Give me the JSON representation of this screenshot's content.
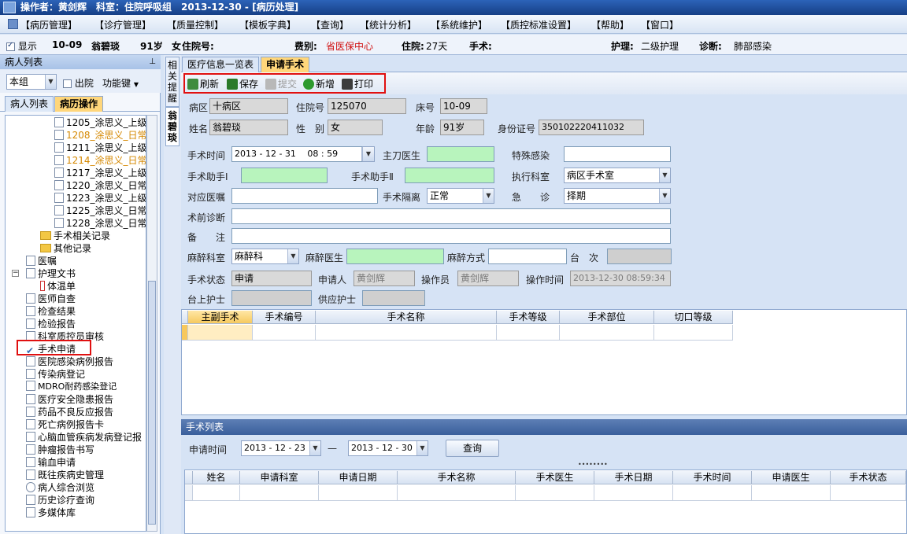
{
  "titlebar": {
    "text": "操作者：黄剑辉　科室：住院呼吸组　2013-12-30 - [病历处理]"
  },
  "menu": [
    "【病历管理】",
    "【诊疗管理】",
    "【质量控制】",
    "【模板字典】",
    "【查询】",
    "【统计分析】",
    "【系统维护】",
    "【质控标准设置】",
    "【帮助】",
    "【窗口】"
  ],
  "patient": {
    "show_label": "显示",
    "bed": "10-09",
    "name": "翁碧琰",
    "age": "91岁",
    "sex": "女",
    "inpatient_label": "住院号:",
    "inpatient_no": "125070",
    "fee_label": "费别:",
    "fee": "省医保中心",
    "stay_label": "住院:",
    "stay": "27天",
    "surgery_label": "手术:",
    "nursing_label": "护理:",
    "nursing": "二级护理",
    "diagnosis_label": "诊断:",
    "diagnosis": "肺部感染"
  },
  "left": {
    "header": "病人列表",
    "group_combo": "本组",
    "discharge_label": "出院",
    "func_label": "功能键",
    "tab_patients": "病人列表",
    "tab_records": "病历操作",
    "tree_top": [
      "1205_涂思义_上级",
      "1208_涂思义_日常",
      "1211_涂思义_上级",
      "1214_涂思义_日常",
      "1217_涂思义_上级",
      "1220_涂思义_日常",
      "1223_涂思义_上级",
      "1225_涂思义_日常",
      "1228_涂思义_日常"
    ],
    "tree_folders": [
      "手术相关记录",
      "其他记录"
    ],
    "tree_items": [
      "医嘱",
      "护理文书",
      "体温单",
      "医师自查",
      "检查结果",
      "检验报告",
      "科室质控员审核",
      "手术申请",
      "医院感染病例报告",
      "传染病登记",
      "MDRO耐药感染登记",
      "医疗安全隐患报告",
      "药品不良反应报告",
      "死亡病例报告卡",
      "心脑血管疾病发病登记报",
      "肿瘤报告书写",
      "输血申请",
      "既往疾病史管理",
      "病人综合浏览",
      "历史诊疗查询",
      "多媒体库"
    ]
  },
  "vtabs": {
    "related": "相关提醒",
    "patient": "翁碧琰"
  },
  "tabs": {
    "overview": "医疗信息一览表",
    "apply": "申请手术"
  },
  "toolbar": {
    "refresh": "刷新",
    "save": "保存",
    "submit": "提交",
    "add": "新增",
    "print": "打印"
  },
  "header_form": {
    "ward_label": "病区",
    "ward": "十病区",
    "inno_label": "住院号",
    "inno": "125070",
    "bed_label": "床号",
    "bed": "10-09",
    "name_label": "姓名",
    "name": "翁碧琰",
    "sex_label": "性　别",
    "sex": "女",
    "age_label": "年龄",
    "age": "91岁",
    "id_label": "身份证号",
    "id": "350102220411032"
  },
  "form": {
    "time_label": "手术时间",
    "time": "2013 - 12 - 31　 08 : 59",
    "surgeon_label": "主刀医生",
    "special_label": "特殊感染",
    "assist1_label": "手术助手Ⅰ",
    "assist2_label": "手术助手Ⅱ",
    "dept_label": "执行科室",
    "dept": "病区手术室",
    "order_label": "对应医嘱",
    "isolation_label": "手术隔离",
    "isolation": "正常",
    "emergency_label": "急　　诊",
    "emergency": "择期",
    "prediag_label": "术前诊断",
    "remark_label": "备　　注",
    "anes_dept_label": "麻醉科室",
    "anes_dept": "麻醉科",
    "anes_doc_label": "麻醉医生",
    "anes_method_label": "麻醉方式",
    "table_label": "台　次",
    "status_label": "手术状态",
    "status": "申请",
    "applicant_label": "申请人",
    "applicant": "黄剑辉",
    "operator_label": "操作员",
    "operator": "黄剑辉",
    "optime_label": "操作时间",
    "optime": "2013-12-30 08:59:34",
    "nurse_label": "台上护士",
    "supply_label": "供应护士"
  },
  "grid1_cols": [
    "主副手术",
    "手术编号",
    "手术名称",
    "手术等级",
    "手术部位",
    "切口等级"
  ],
  "list": {
    "header": "手术列表",
    "date_label": "申请时间",
    "from": "2013 - 12 - 23",
    "dash": "—",
    "to": "2013 - 12 - 30",
    "query": "查询",
    "dots": "••••••••"
  },
  "grid2_cols": [
    "姓名",
    "申请科室",
    "申请日期",
    "手术名称",
    "手术医生",
    "手术日期",
    "手术时间",
    "申请医生",
    "手术状态"
  ]
}
